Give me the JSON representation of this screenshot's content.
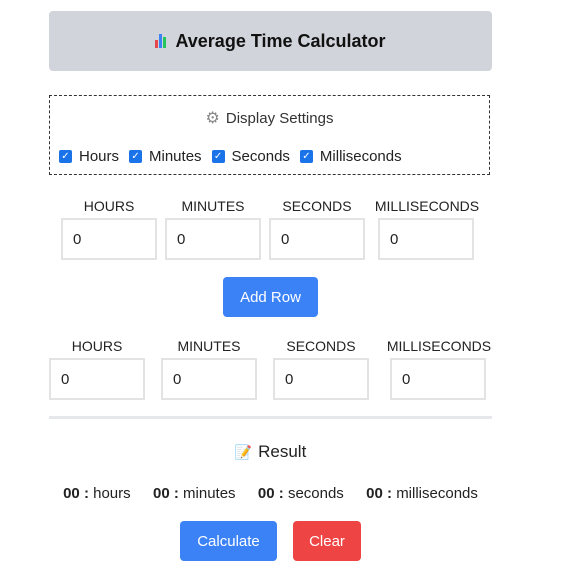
{
  "header": {
    "title": "Average Time Calculator",
    "icon": "bar-chart-icon"
  },
  "settings": {
    "title": "Display Settings",
    "icon": "gear-icon",
    "options": [
      {
        "label": "Hours",
        "checked": true
      },
      {
        "label": "Minutes",
        "checked": true
      },
      {
        "label": "Seconds",
        "checked": true
      },
      {
        "label": "Milliseconds",
        "checked": true
      }
    ]
  },
  "rows": [
    {
      "labels": [
        "HOURS",
        "MINUTES",
        "SECONDS",
        "MILLISECONDS"
      ],
      "values": [
        "0",
        "0",
        "0",
        "0"
      ]
    },
    {
      "labels": [
        "HOURS",
        "MINUTES",
        "SECONDS",
        "MILLISECONDS"
      ],
      "values": [
        "0",
        "0",
        "0",
        "0"
      ]
    }
  ],
  "add_row_label": "Add Row",
  "result": {
    "title": "Result",
    "icon": "memo-icon",
    "hours": "00",
    "minutes": "00",
    "seconds": "00",
    "milliseconds": "00",
    "sep": ":",
    "hours_unit": "hours",
    "minutes_unit": "minutes",
    "seconds_unit": "seconds",
    "milliseconds_unit": "milliseconds"
  },
  "buttons": {
    "calculate": "Calculate",
    "clear": "Clear"
  },
  "colors": {
    "primary": "#3b82f6",
    "danger": "#ef4444",
    "header_bg": "#d1d5db"
  }
}
